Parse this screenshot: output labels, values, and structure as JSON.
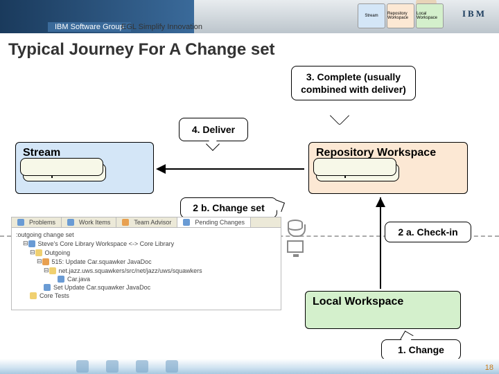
{
  "header": {
    "group": "IBM Software Group",
    "tagline": "EGL Simplify Innovation",
    "logo": "IBM",
    "mini": {
      "stream": "Stream",
      "repo": "Repository Workspace",
      "local": "Local Workspace"
    }
  },
  "title": "Typical Journey For A Change set",
  "steps": {
    "s1": "1. Change",
    "s2a": "2 a. Check-in",
    "s2b": "2 b. Change set",
    "s3": "3. Complete (usually combined with deliver)",
    "s4": "4. Deliver"
  },
  "boxes": {
    "stream": "Stream",
    "repo": "Repository Workspace",
    "local": "Local Workspace",
    "component": "Component"
  },
  "ide": {
    "tabs": [
      "Problems",
      "Work Items",
      "Team Advisor",
      "Pending Changes"
    ],
    "active_tab": 3,
    "section": "outgoing change set",
    "lines": [
      "Steve's Core Library Workspace <-> Core Library",
      "Outgoing",
      "515: Update Car.squawker JavaDoc",
      "net.jazz.uws.squawkers/src/net/jazz/uws/squawkers",
      "Car.java",
      "Set Update Car.squawker JavaDoc",
      "Core Tests"
    ]
  },
  "page": "18"
}
